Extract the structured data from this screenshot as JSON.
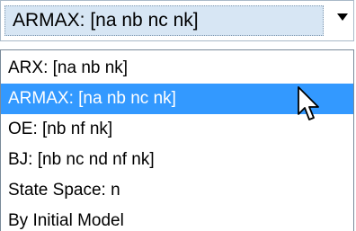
{
  "combo": {
    "value": "ARMAX: [na nb nc nk]",
    "arrow_icon": "dropdown-arrow-icon"
  },
  "list": {
    "items": [
      {
        "label": "ARX: [na nb nk]"
      },
      {
        "label": "ARMAX: [na nb nc nk]",
        "selected": true
      },
      {
        "label": "OE: [nb nf nk]"
      },
      {
        "label": "BJ: [nb nc nd nf nk]"
      },
      {
        "label": "State Space: n"
      },
      {
        "label": "By Initial Model"
      }
    ]
  },
  "cursor": {
    "icon": "mouse-pointer-icon"
  },
  "colors": {
    "selection": "#3399ff",
    "combo_focus": "#d7e6f4"
  }
}
